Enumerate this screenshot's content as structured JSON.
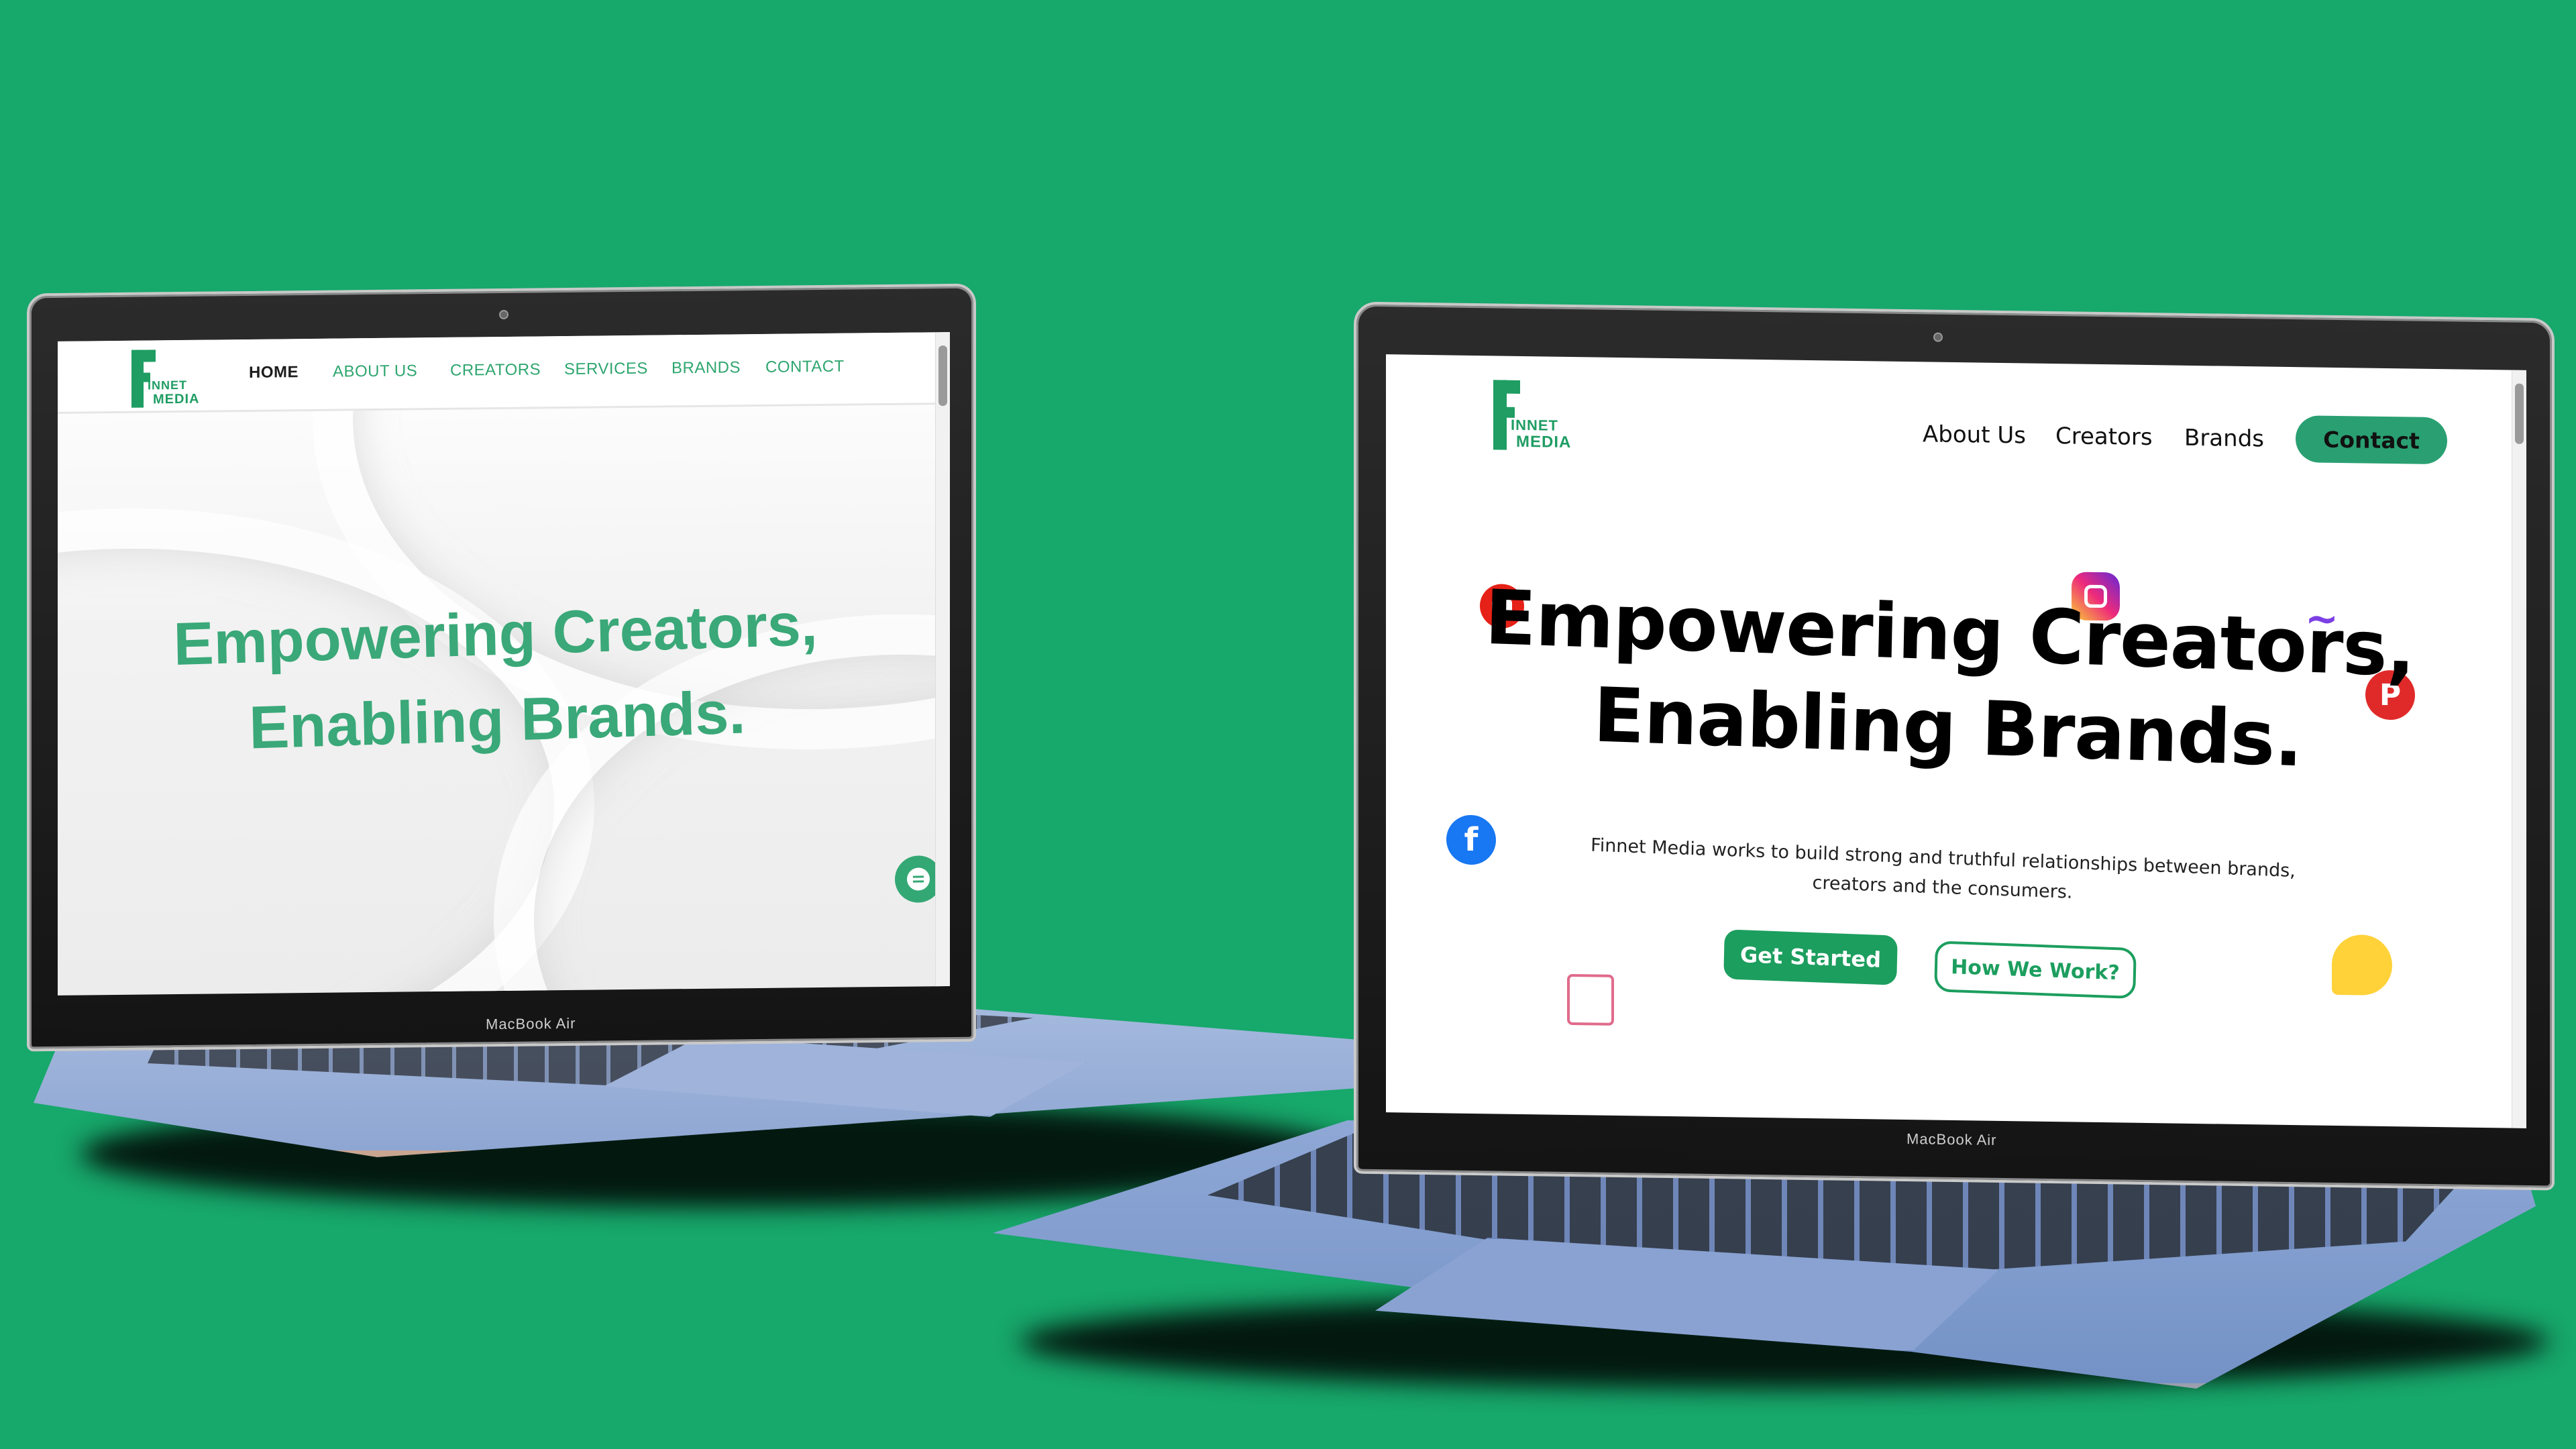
{
  "background_color": "#17a86b",
  "left_laptop": {
    "bezel_label": "MacBook Air",
    "logo": {
      "letter": "F",
      "line1": "INNET",
      "line2": "MEDIA"
    },
    "nav": [
      {
        "label": "HOME",
        "active": true
      },
      {
        "label": "ABOUT US",
        "active": false
      },
      {
        "label": "CREATORS",
        "active": false
      },
      {
        "label": "SERVICES",
        "active": false
      },
      {
        "label": "BRANDS",
        "active": false
      },
      {
        "label": "CONTACT",
        "active": false
      }
    ],
    "headline_line1": "Empowering Creators,",
    "headline_line2": "Enabling Brands.",
    "chat_icon": "chat-bubble-icon",
    "accent_color": "#3aa878"
  },
  "right_laptop": {
    "bezel_label": "MacBook Air",
    "logo": {
      "letter": "F",
      "line1": "INNET",
      "line2": "MEDIA"
    },
    "nav": [
      {
        "label": "About Us"
      },
      {
        "label": "Creators"
      },
      {
        "label": "Brands"
      }
    ],
    "contact_label": "Contact",
    "headline_line1": "Empowering Creators,",
    "headline_line2": "Enabling Brands.",
    "subtext_line1": "Finnet Media works to build strong and truthful relationships between brands,",
    "subtext_line2": "creators and the consumers.",
    "primary_button": "Get Started",
    "secondary_button": "How We Work?",
    "social_icons": [
      "youtube-icon",
      "instagram-icon",
      "pinterest-icon",
      "facebook-icon",
      "confetti-icon",
      "party-icon",
      "analytics-icon"
    ],
    "accent_color": "#1c9e5e"
  }
}
